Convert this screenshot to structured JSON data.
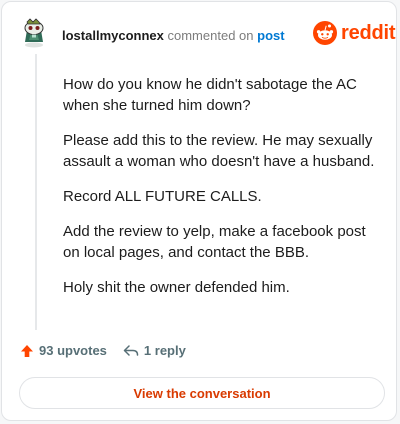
{
  "header": {
    "username": "lostallmyconnex",
    "action_text": "commented on",
    "post_link": "post",
    "avatar_icon": "snoo-avatar-icon",
    "brand_wordmark": "reddit",
    "brand_color": "#ff4500"
  },
  "comment": {
    "paragraphs": [
      "How do you know he didn't sabotage the AC when she turned him down?",
      "Please add this to the review. He may sexually assault a woman who doesn't have a husband.",
      "Record ALL FUTURE CALLS.",
      "Add the review to yelp, make a facebook post on local pages, and contact the BBB.",
      "Holy shit the owner defended him."
    ]
  },
  "actions": {
    "upvotes_label": "93 upvotes",
    "upvote_icon": "upvote-arrow-icon",
    "replies_label": "1 reply",
    "reply_icon": "reply-arrow-icon",
    "upvote_color": "#ff4500"
  },
  "footer": {
    "view_button_label": "View the conversation",
    "link_color": "#d93a00"
  }
}
